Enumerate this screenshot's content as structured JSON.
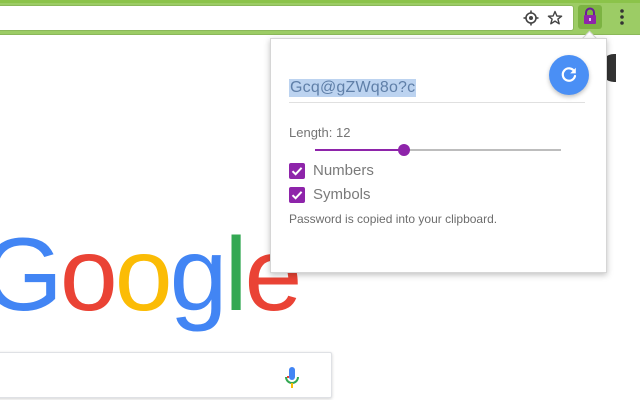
{
  "browser": {
    "location_icon": "location-target-icon",
    "bookmark_icon": "star-icon",
    "extension_icon": "lock-icon",
    "menu_icon": "three-dots-vertical-icon",
    "theme_color": "#9ccc65"
  },
  "page": {
    "logo_letters": [
      "G",
      "o",
      "o",
      "g",
      "l",
      "e"
    ],
    "mic_icon": "microphone-icon"
  },
  "popup": {
    "password": "Gcq@gZWq8o?c",
    "refresh_icon": "refresh-icon",
    "length_label": "Length: 12",
    "length_value": 12,
    "slider_fraction": 0.36,
    "options": [
      {
        "label": "Numbers",
        "checked": true
      },
      {
        "label": "Symbols",
        "checked": true
      }
    ],
    "status": "Password is copied into your clipboard.",
    "accent_color": "#8e24aa",
    "button_color": "#4a8ff5"
  }
}
